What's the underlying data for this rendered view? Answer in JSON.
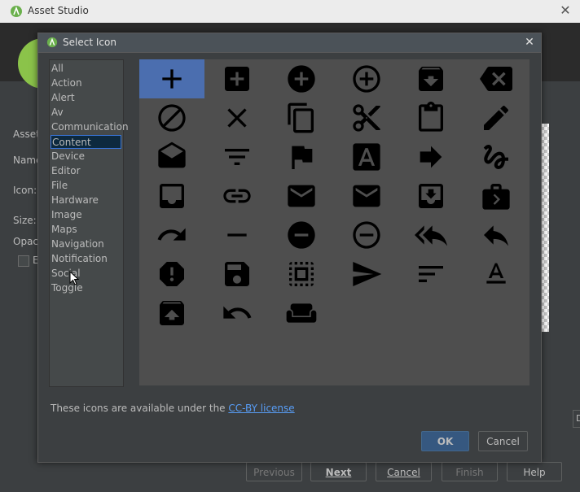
{
  "outer": {
    "title": "Asset Studio",
    "close_glyph": "✕",
    "labels": [
      "Asset",
      "Name",
      "Icon:",
      "Size:",
      "Opac"
    ],
    "checkbox_label": "E",
    "right_box_text": "D",
    "buttons": {
      "previous": "Previous",
      "next": "Next",
      "cancel": "Cancel",
      "finish": "Finish",
      "help": "Help"
    }
  },
  "dialog": {
    "title": "Select Icon",
    "close_glyph": "✕",
    "categories": [
      "All",
      "Action",
      "Alert",
      "Av",
      "Communication",
      "Content",
      "Device",
      "Editor",
      "File",
      "Hardware",
      "Image",
      "Maps",
      "Navigation",
      "Notification",
      "Social",
      "Toggle"
    ],
    "selected_category": "Content",
    "icons": [
      "add-icon",
      "add-box-icon",
      "add-circle-icon",
      "add-circle-outline-icon",
      "archive-icon",
      "backspace-icon",
      "block-icon",
      "clear-icon",
      "content-copy-icon",
      "content-cut-icon",
      "content-paste-icon",
      "create-icon",
      "drafts-icon",
      "filter-list-icon",
      "flag-icon",
      "font-download-icon",
      "forward-icon",
      "gesture-icon",
      "inbox-icon",
      "link-icon",
      "mail-icon",
      "markunread-icon",
      "move-to-inbox-icon",
      "next-week-icon",
      "redo-icon",
      "remove-icon",
      "remove-circle-icon",
      "remove-circle-outline-icon",
      "reply-all-icon",
      "reply-icon",
      "report-icon",
      "save-icon",
      "select-all-icon",
      "send-icon",
      "sort-icon",
      "text-format-icon",
      "unarchive-icon",
      "undo-icon",
      "weekend-icon"
    ],
    "selected_icon": "add-icon",
    "license_prefix": "These icons are available under the ",
    "license_link": "CC-BY license",
    "ok": "OK",
    "cancel": "Cancel"
  },
  "colors": {
    "background": "#3c3f41",
    "selection": "#4b6eaf",
    "primary_button": "#365880",
    "link": "#589df6",
    "icon": "#000000"
  }
}
